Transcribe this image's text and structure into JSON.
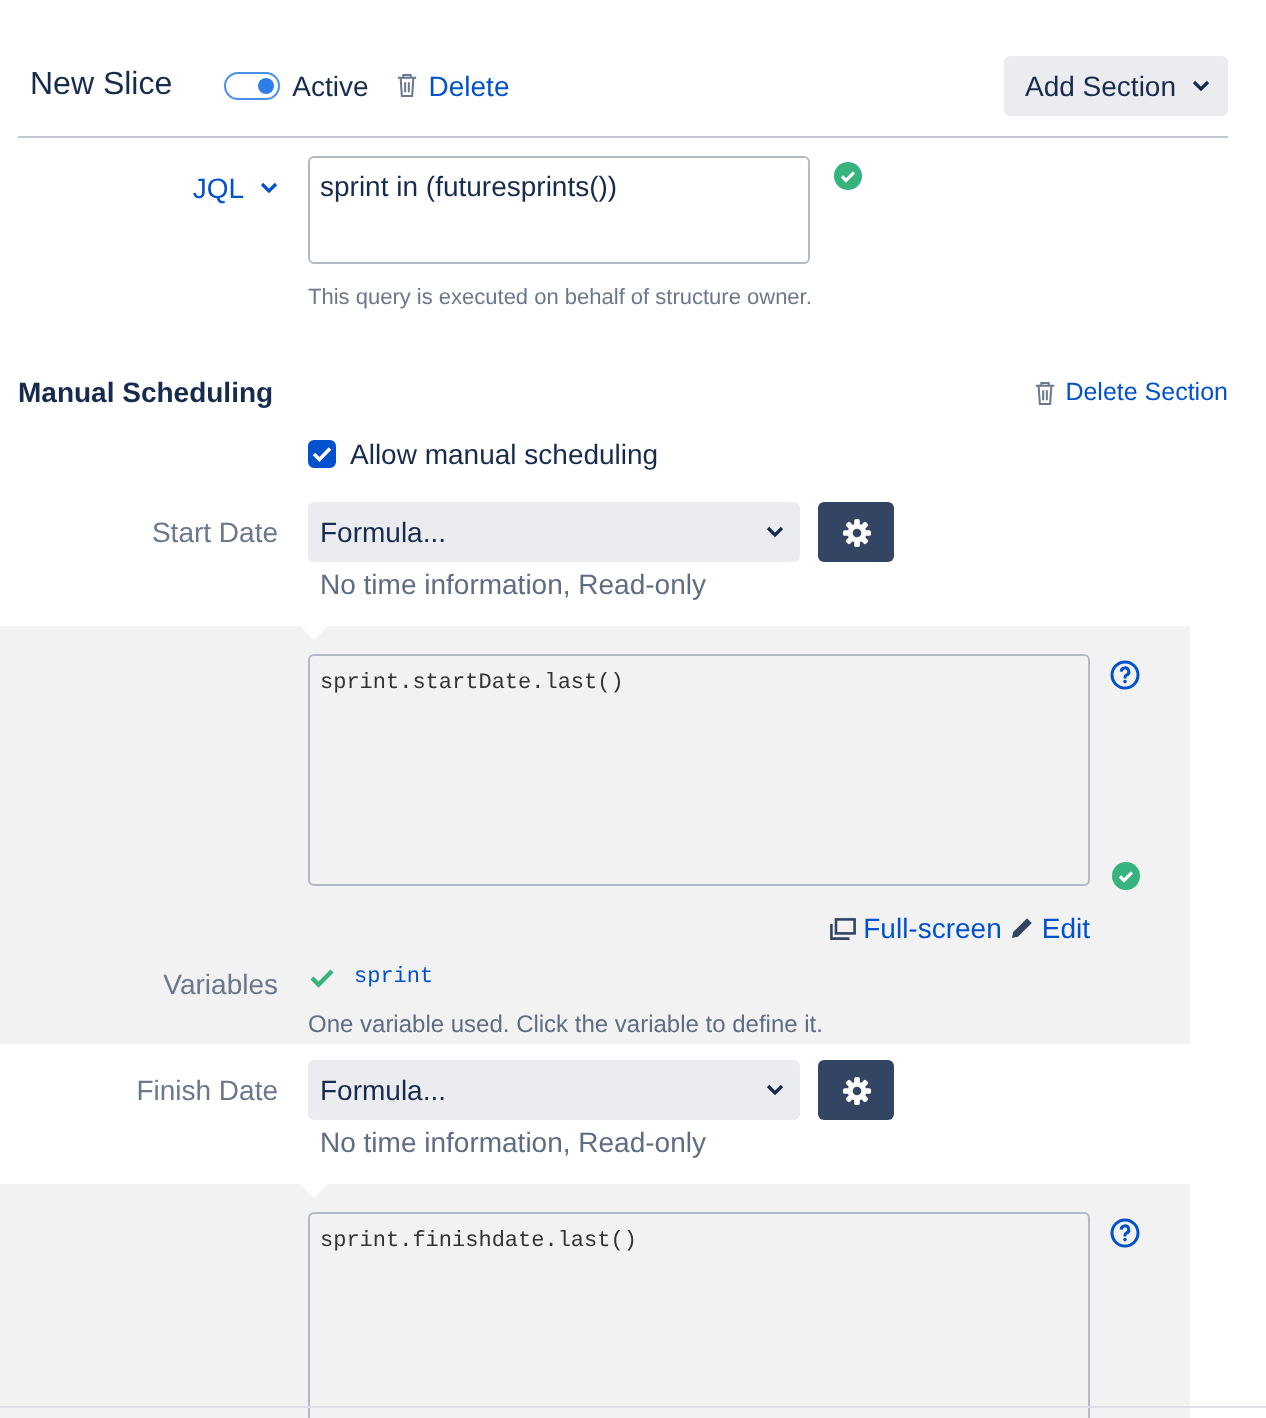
{
  "header": {
    "title": "New Slice",
    "toggle": {
      "label": "Active",
      "on": true
    },
    "delete_link": "Delete",
    "add_section": "Add Section"
  },
  "jql": {
    "selector": "JQL",
    "query": "sprint in (futuresprints())",
    "valid": true,
    "hint": "This query is executed on behalf of structure owner."
  },
  "section": {
    "title": "Manual Scheduling",
    "delete_section": "Delete Section",
    "allow_manual": {
      "label": "Allow manual scheduling",
      "checked": true
    },
    "fields": [
      {
        "label": "Start Date",
        "select": "Formula...",
        "note": "No time information, Read-only",
        "formula": {
          "code": "sprint.startDate.last()",
          "valid": true,
          "links": [
            "Full-screen",
            "Edit"
          ],
          "variables_label": "Variables",
          "variables": [
            {
              "name": "sprint",
              "defined": true
            }
          ],
          "variables_note": "One variable used. Click the variable to define it."
        }
      },
      {
        "label": "Finish Date",
        "select": "Formula...",
        "note": "No time information, Read-only",
        "formula": {
          "code": "sprint.finishdate.last()"
        }
      }
    ]
  }
}
